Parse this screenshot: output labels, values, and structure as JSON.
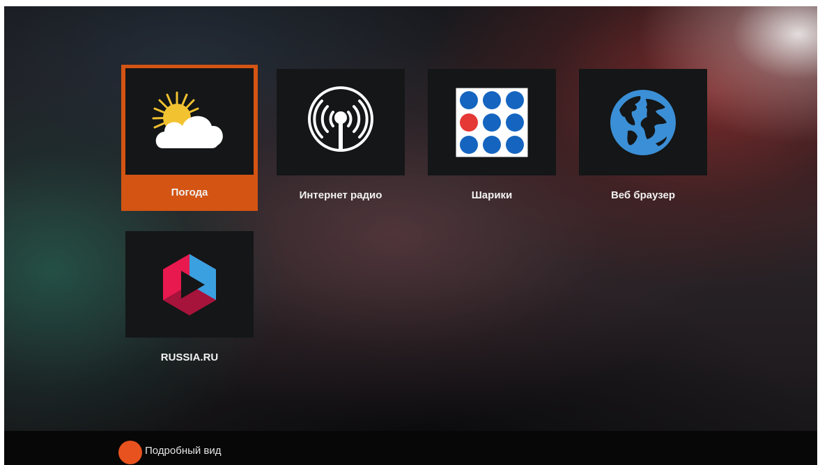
{
  "apps": [
    {
      "label": "Погода",
      "icon": "weather-sun-cloud-icon",
      "selected": true
    },
    {
      "label": "Интернет радио",
      "icon": "radio-antenna-icon",
      "selected": false
    },
    {
      "label": "Шарики",
      "icon": "balls-grid-icon",
      "selected": false
    },
    {
      "label": "Веб браузер",
      "icon": "globe-icon",
      "selected": false
    },
    {
      "label": "RUSSIA.RU",
      "icon": "russia-ru-logo-icon",
      "selected": false
    }
  ],
  "bottombar": {
    "hint_label": "Подробный вид",
    "hint_button_color": "#e8521e"
  },
  "colors": {
    "selection": "#d35413",
    "tile_background": "#141617",
    "balls_blue": "#1565c0",
    "balls_red": "#e53935",
    "globe_blue": "#3b8fd6"
  }
}
